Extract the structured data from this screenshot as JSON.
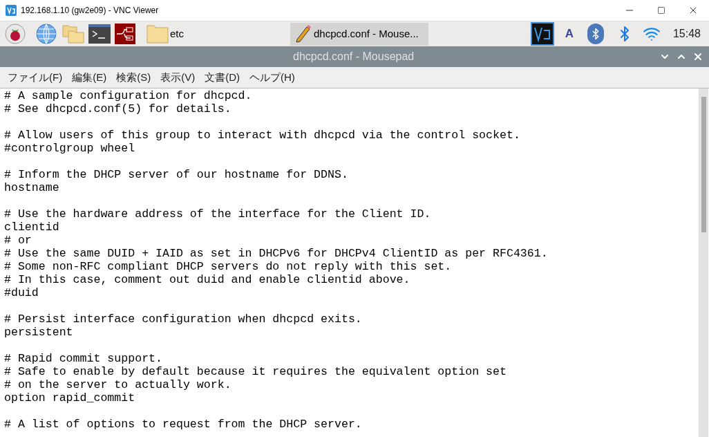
{
  "vnc_window": {
    "title": "192.168.1.10 (gw2e09) - VNC Viewer"
  },
  "taskbar": {
    "folder_label": "etc",
    "task_button": {
      "label": "dhcpcd.conf - Mouse...",
      "selected": true
    },
    "clock": "15:48",
    "tray_letter": "A"
  },
  "editor_window": {
    "title": "dhcpcd.conf - Mousepad"
  },
  "menu": [
    "ファイル(F)",
    "編集(E)",
    "検索(S)",
    "表示(V)",
    "文書(D)",
    "ヘルプ(H)"
  ],
  "document": {
    "blocks": [
      [
        "# A sample configuration for dhcpcd.",
        "# See dhcpcd.conf(5) for details."
      ],
      [
        "# Allow users of this group to interact with dhcpcd via the control socket.",
        "#controlgroup wheel"
      ],
      [
        "# Inform the DHCP server of our hostname for DDNS.",
        "hostname"
      ],
      [
        "# Use the hardware address of the interface for the Client ID.",
        "clientid",
        "# or",
        "# Use the same DUID + IAID as set in DHCPv6 for DHCPv4 ClientID as per RFC4361.",
        "# Some non-RFC compliant DHCP servers do not reply with this set.",
        "# In this case, comment out duid and enable clientid above.",
        "#duid"
      ],
      [
        "# Persist interface configuration when dhcpcd exits.",
        "persistent"
      ],
      [
        "# Rapid commit support.",
        "# Safe to enable by default because it requires the equivalent option set",
        "# on the server to actually work.",
        "option rapid_commit"
      ],
      [
        "# A list of options to request from the DHCP server."
      ]
    ]
  }
}
